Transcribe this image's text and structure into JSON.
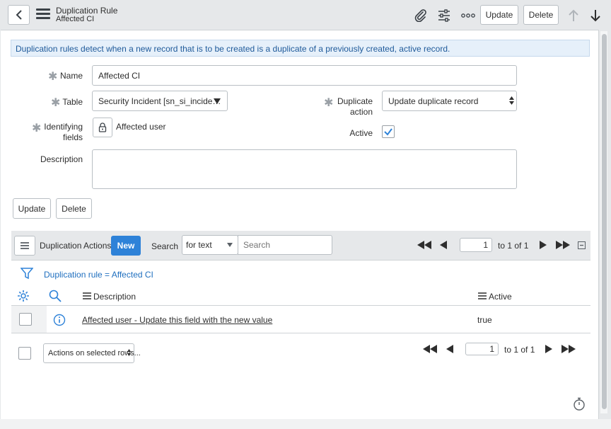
{
  "header": {
    "title": "Duplication Rule",
    "subtitle": "Affected CI",
    "update_label": "Update",
    "delete_label": "Delete"
  },
  "info_message": "Duplication rules detect when a new record that is to be created is a duplicate of a previously created, active record.",
  "form": {
    "name_label": "Name",
    "name_value": "Affected CI",
    "table_label": "Table",
    "table_value": "Security Incident [sn_si_incide…",
    "duplicate_label_1": "Duplicate",
    "duplicate_label_2": "action",
    "duplicate_value": "Update duplicate record",
    "identifying_label_1": "Identifying",
    "identifying_label_2": "fields",
    "identifying_value": "Affected user",
    "active_label": "Active",
    "active_checked": true,
    "description_label": "Description",
    "description_value": ""
  },
  "form_buttons": {
    "update_label": "Update",
    "delete_label": "Delete"
  },
  "related_list": {
    "title": "Duplication Actions",
    "new_label": "New",
    "search_label": "Search",
    "search_select": "for text",
    "search_placeholder": "Search",
    "page_value": "1",
    "page_of": "to 1 of 1",
    "filter_text": "Duplication rule = Affected CI",
    "columns": [
      "Description",
      "Active"
    ],
    "rows": [
      {
        "description": "Affected user - Update this field with the new value",
        "active": "true"
      }
    ],
    "actions_select": "Actions on selected rows...",
    "bottom_page_value": "1",
    "bottom_page_of": "to 1 of 1"
  },
  "colors": {
    "accent": "#2e82d8",
    "info_bg": "#e6f0fa",
    "link": "#1f6fbf"
  }
}
